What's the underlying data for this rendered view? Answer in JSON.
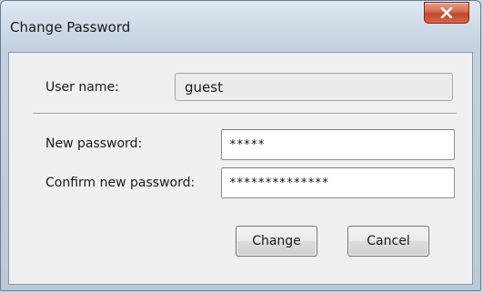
{
  "window": {
    "title": "Change Password",
    "close_icon": "close-icon"
  },
  "form": {
    "username_label": "User name:",
    "username_value": "guest",
    "new_password_label": "New password:",
    "new_password_value": "*****",
    "confirm_password_label": "Confirm new password:",
    "confirm_password_value": "**************"
  },
  "buttons": {
    "change_label": "Change",
    "cancel_label": "Cancel"
  },
  "colors": {
    "close_button": "#c94a2e",
    "frame": "#c3d0de",
    "client_background": "#f0f0f0"
  }
}
